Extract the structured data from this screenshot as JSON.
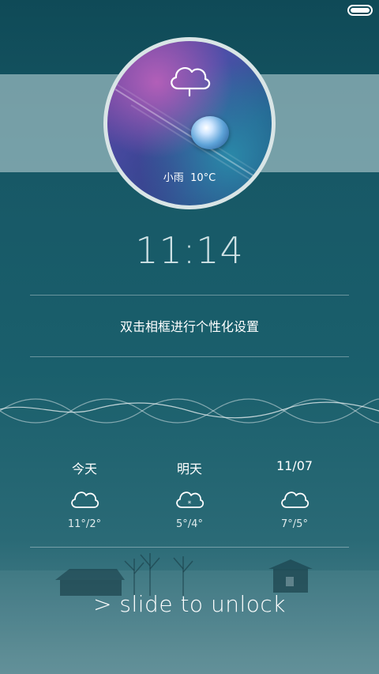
{
  "frame": {
    "weather": "小雨",
    "temperature": "10°C",
    "icon": "cloud-rain-icon"
  },
  "clock": {
    "time": "11:14"
  },
  "hint_text": "双击相框进行个性化设置",
  "forecast": [
    {
      "label": "今天",
      "icon": "cloud-icon",
      "temp": "11°/2°"
    },
    {
      "label": "明天",
      "icon": "cloud-snow-icon",
      "temp": "5°/4°"
    },
    {
      "label": "11/07",
      "icon": "cloud-icon",
      "temp": "7°/5°"
    }
  ],
  "unlock": {
    "text": "> slide to unlock"
  },
  "colors": {
    "background": "#175866",
    "band": "#a7c4c8",
    "frame_border": "#d9e5e6"
  }
}
